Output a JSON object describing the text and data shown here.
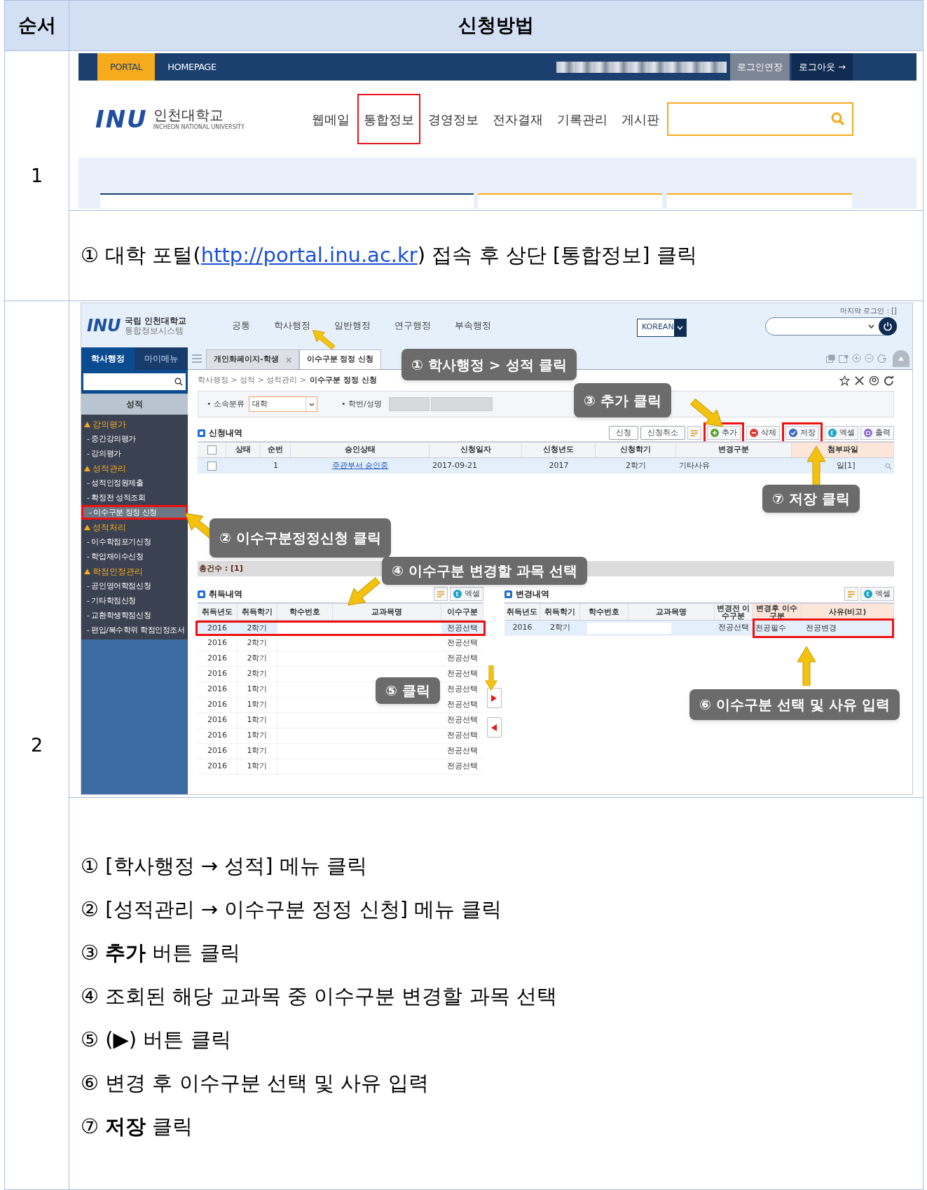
{
  "header": {
    "order": "순서",
    "method": "신청방법"
  },
  "step1": {
    "number": "1",
    "portal": {
      "top_tabs": [
        {
          "label": "PORTAL",
          "selected": true
        },
        {
          "label": "HOMEPAGE",
          "selected": false
        }
      ],
      "session_buttons": [
        "로그인연장",
        "로그아웃 →"
      ],
      "logo_mark": "INU",
      "logo_name": "인천대학교",
      "logo_subtitle": "INCHEON NATIONAL UNIVERSITY",
      "menu": [
        {
          "label": "웹메일",
          "highlighted": false
        },
        {
          "label": "통합정보",
          "highlighted": true
        },
        {
          "label": "경영정보",
          "highlighted": false
        },
        {
          "label": "전자결재",
          "highlighted": false
        },
        {
          "label": "기록관리",
          "highlighted": false
        },
        {
          "label": "게시판",
          "highlighted": false
        }
      ]
    },
    "instruction": {
      "before": "① 대학 포털(",
      "link": "http://portal.inu.ac.kr",
      "after": ") 접속 후 상단 [통합정보] 클릭"
    }
  },
  "step2": {
    "number": "2",
    "screen": {
      "logo_mark": "INU",
      "logo_title": "국립 인천대학교",
      "logo_subtitle": "통합정보시스템",
      "top_menu": [
        "공통",
        "학사행정",
        "일반행정",
        "연구행정",
        "부속행정"
      ],
      "language": "KOREAN",
      "last_login": "마지막 로그인 : []",
      "sidebar_tabs": [
        {
          "label": "학사행정",
          "selected": true
        },
        {
          "label": "마이메뉴",
          "selected": false
        }
      ],
      "sidebar_title": "성적",
      "tree": [
        {
          "label": "강의평가",
          "expanded": true,
          "children": [
            {
              "label": "- 중간강의평가",
              "selected": false
            },
            {
              "label": "- 강의평가",
              "selected": false
            }
          ]
        },
        {
          "label": "성적관리",
          "expanded": true,
          "children": [
            {
              "label": "- 성적인정원제출",
              "selected": false
            },
            {
              "label": "- 확정전 성적조회",
              "selected": false
            },
            {
              "label": "- 이수구분 정정 신청",
              "selected": true
            }
          ]
        },
        {
          "label": "성적처리",
          "expanded": true,
          "children": [
            {
              "label": "- 이수학점포기신청",
              "selected": false
            },
            {
              "label": "- 학업재이수신청",
              "selected": false
            }
          ]
        },
        {
          "label": "학점인정관리",
          "expanded": true,
          "children": [
            {
              "label": "- 공인영어학점신청",
              "selected": false
            },
            {
              "label": "- 기타학점신청",
              "selected": false
            },
            {
              "label": "- 교환학생학점신청",
              "selected": false
            },
            {
              "label": "- 편입/복수학위 학점인정조서",
              "selected": false
            }
          ]
        }
      ],
      "tabs": [
        {
          "label": "개인화페이지-학생",
          "selected": false,
          "closable": true
        },
        {
          "label": "이수구분 정정 신청",
          "selected": true,
          "closable": false
        }
      ],
      "breadcrumb": "학사행정 > 성적 > 성적관리 >",
      "page_title": "이수구분 정정 신청",
      "filters": {
        "division_label": "• 소속분류",
        "division_value": "대학",
        "student_label": "• 학번/성명"
      },
      "application": {
        "title": "신청내역",
        "toolbar": [
          {
            "kind": "text",
            "label": "신청"
          },
          {
            "kind": "text",
            "label": "신청취소"
          },
          {
            "kind": "sort"
          },
          {
            "kind": "add",
            "label": "추가"
          },
          {
            "kind": "delete",
            "label": "삭제"
          },
          {
            "kind": "save",
            "label": "저장"
          },
          {
            "kind": "excel",
            "label": "엑셀"
          },
          {
            "kind": "print",
            "label": "출력"
          }
        ],
        "select_all_checked": false,
        "columns": [
          "상태",
          "순번",
          "승인상태",
          "신청일자",
          "신청년도",
          "신청학기",
          "변경구분",
          "첨부파일"
        ],
        "rows": [
          {
            "checked": false,
            "number": "1",
            "approval": "주관부서 승인중",
            "date": "2017-09-21",
            "year": "2017",
            "term": "2학기",
            "change_type": "기타사유",
            "attachment": "일[1]"
          }
        ],
        "total": "총건수 : [1]"
      },
      "acquired": {
        "title": "취득내역",
        "toolbar": [
          {
            "kind": "sort"
          },
          {
            "kind": "excel",
            "label": "엑셀"
          }
        ],
        "columns": [
          "취득년도",
          "취득학기",
          "학수번호",
          "교과목명",
          "이수구분"
        ],
        "rows": [
          {
            "year": "2016",
            "term": "2학기",
            "category": "전공선택",
            "selected": true
          },
          {
            "year": "2016",
            "term": "2학기",
            "category": "전공선택",
            "selected": false
          },
          {
            "year": "2016",
            "term": "2학기",
            "category": "전공선택",
            "selected": false
          },
          {
            "year": "2016",
            "term": "2학기",
            "category": "전공선택",
            "selected": false
          },
          {
            "year": "2016",
            "term": "1학기",
            "category": "전공선택",
            "selected": false
          },
          {
            "year": "2016",
            "term": "1학기",
            "category": "전공선택",
            "selected": false
          },
          {
            "year": "2016",
            "term": "1학기",
            "category": "전공선택",
            "selected": false
          },
          {
            "year": "2016",
            "term": "1학기",
            "category": "전공선택",
            "selected": false
          },
          {
            "year": "2016",
            "term": "1학기",
            "category": "전공선택",
            "selected": false
          },
          {
            "year": "2016",
            "term": "1학기",
            "category": "전공선택",
            "selected": false
          }
        ]
      },
      "changes": {
        "title": "변경내역",
        "toolbar": [
          {
            "kind": "sort"
          },
          {
            "kind": "excel",
            "label": "엑셀"
          }
        ],
        "columns": [
          "취득년도",
          "취득학기",
          "학수번호",
          "교과목명",
          "변경전 이수구분",
          "변경후 이수구분",
          "사유(비고)"
        ],
        "rows": [
          {
            "year": "2016",
            "term": "2학기",
            "before": "전공선택",
            "after": "전공필수",
            "reason": "전공변경",
            "selected": true
          }
        ]
      },
      "callouts": [
        "① 학사행정 > 성적 클릭",
        "③ 추가 클릭",
        "⑦ 저장 클릭",
        "② 이수구분정정신청 클릭",
        "④ 이수구분 변경할 과목 선택",
        "⑤ 클릭",
        "⑥ 이수구분 선택 및 사유 입력"
      ]
    },
    "instructions": [
      "① [학사행정 → 성적] 메뉴 클릭",
      "② [성적관리 → 이수구분 정정 신청] 메뉴 클릭",
      "③ **추가** 버튼 클릭",
      "④ 조회된 해당 교과목 중 이수구분 변경할 과목 선택",
      "⑤ (▶) 버튼 클릭",
      "⑥ 변경 후 이수구분 선택 및 사유 입력",
      "⑦ **저장** 클릭"
    ]
  }
}
